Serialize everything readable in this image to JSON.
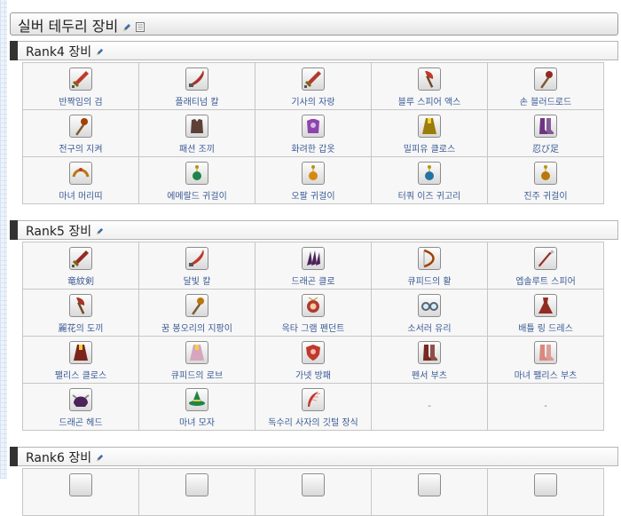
{
  "page": {
    "title": "실버 테두리 장비"
  },
  "sections": [
    {
      "heading": "Rank4 장비",
      "rows": [
        [
          {
            "name": "반짝임의 검",
            "icon": "sword-icon",
            "color": "#c0392b"
          },
          {
            "name": "플래티넘 칼",
            "icon": "blade-icon",
            "color": "#a93226"
          },
          {
            "name": "기사의 자랑",
            "icon": "sword-icon",
            "color": "#b03a2e"
          },
          {
            "name": "블루 스피어 액스",
            "icon": "axe-icon",
            "color": "#c0392b"
          },
          {
            "name": "손 블러드로드",
            "icon": "staff-icon",
            "color": "#922b21"
          }
        ],
        [
          {
            "name": "전구의 지켜",
            "icon": "staff-icon",
            "color": "#a04000"
          },
          {
            "name": "패션 조끼",
            "icon": "vest-icon",
            "color": "#5d4037"
          },
          {
            "name": "화려한 갑옷",
            "icon": "armor-icon",
            "color": "#8e44ad"
          },
          {
            "name": "밀피유 클로스",
            "icon": "robe-icon",
            "color": "#9a7d0a"
          },
          {
            "name": "忍び足",
            "icon": "boots-icon",
            "color": "#6c3483"
          }
        ],
        [
          {
            "name": "마녀 머리띠",
            "icon": "headband-icon",
            "color": "#b9770e"
          },
          {
            "name": "에메랄드 귀걸이",
            "icon": "earring-icon",
            "color": "#1e8449"
          },
          {
            "name": "오팔 귀걸이",
            "icon": "earring-icon",
            "color": "#d68910"
          },
          {
            "name": "터쿼 이즈 귀고리",
            "icon": "earring-icon",
            "color": "#2471a3"
          },
          {
            "name": "진주 귀걸이",
            "icon": "earring-icon",
            "color": "#b9770e"
          }
        ]
      ]
    },
    {
      "heading": "Rank5 장비",
      "rows": [
        [
          {
            "name": "竜紋剣",
            "icon": "sword-icon",
            "color": "#922b21"
          },
          {
            "name": "달빛 칼",
            "icon": "blade-icon",
            "color": "#c0392b"
          },
          {
            "name": "드래곤 클로",
            "icon": "claw-icon",
            "color": "#4a235a"
          },
          {
            "name": "큐피드의 활",
            "icon": "bow-icon",
            "color": "#a04000"
          },
          {
            "name": "엡솔루트 스피어",
            "icon": "spear-icon",
            "color": "#943126"
          }
        ],
        [
          {
            "name": "麗花의 도끼",
            "icon": "axe-icon",
            "color": "#a93226"
          },
          {
            "name": "꿈 봉오리의 지팡이",
            "icon": "staff-icon",
            "color": "#b9770e"
          },
          {
            "name": "옥타 그램 펜던트",
            "icon": "pendant-icon",
            "color": "#b03a2e"
          },
          {
            "name": "소서러 유리",
            "icon": "glass-icon",
            "color": "#566573"
          },
          {
            "name": "배틀 링 드레스",
            "icon": "dress-icon",
            "color": "#922b21"
          }
        ],
        [
          {
            "name": "팰리스 클로스",
            "icon": "robe-icon",
            "color": "#7b241c"
          },
          {
            "name": "큐피드의 로브",
            "icon": "robe-icon",
            "color": "#d5a6bd"
          },
          {
            "name": "가넷 방패",
            "icon": "shield-icon",
            "color": "#c0392b"
          },
          {
            "name": "펜서 부츠",
            "icon": "boots-icon",
            "color": "#78281f"
          },
          {
            "name": "마녀 팰리스 부츠",
            "icon": "boots-icon",
            "color": "#d98880"
          }
        ],
        [
          {
            "name": "드래곤 헤드",
            "icon": "helmet-icon",
            "color": "#4a235a"
          },
          {
            "name": "마녀 모자",
            "icon": "hat-icon",
            "color": "#1e8449"
          },
          {
            "name": "독수리 사자의 깃털 장식",
            "icon": "feather-icon",
            "color": "#c0392b"
          },
          {
            "empty": "-"
          },
          {
            "empty": "-"
          }
        ]
      ]
    },
    {
      "heading": "Rank6 장비",
      "rows": []
    }
  ]
}
